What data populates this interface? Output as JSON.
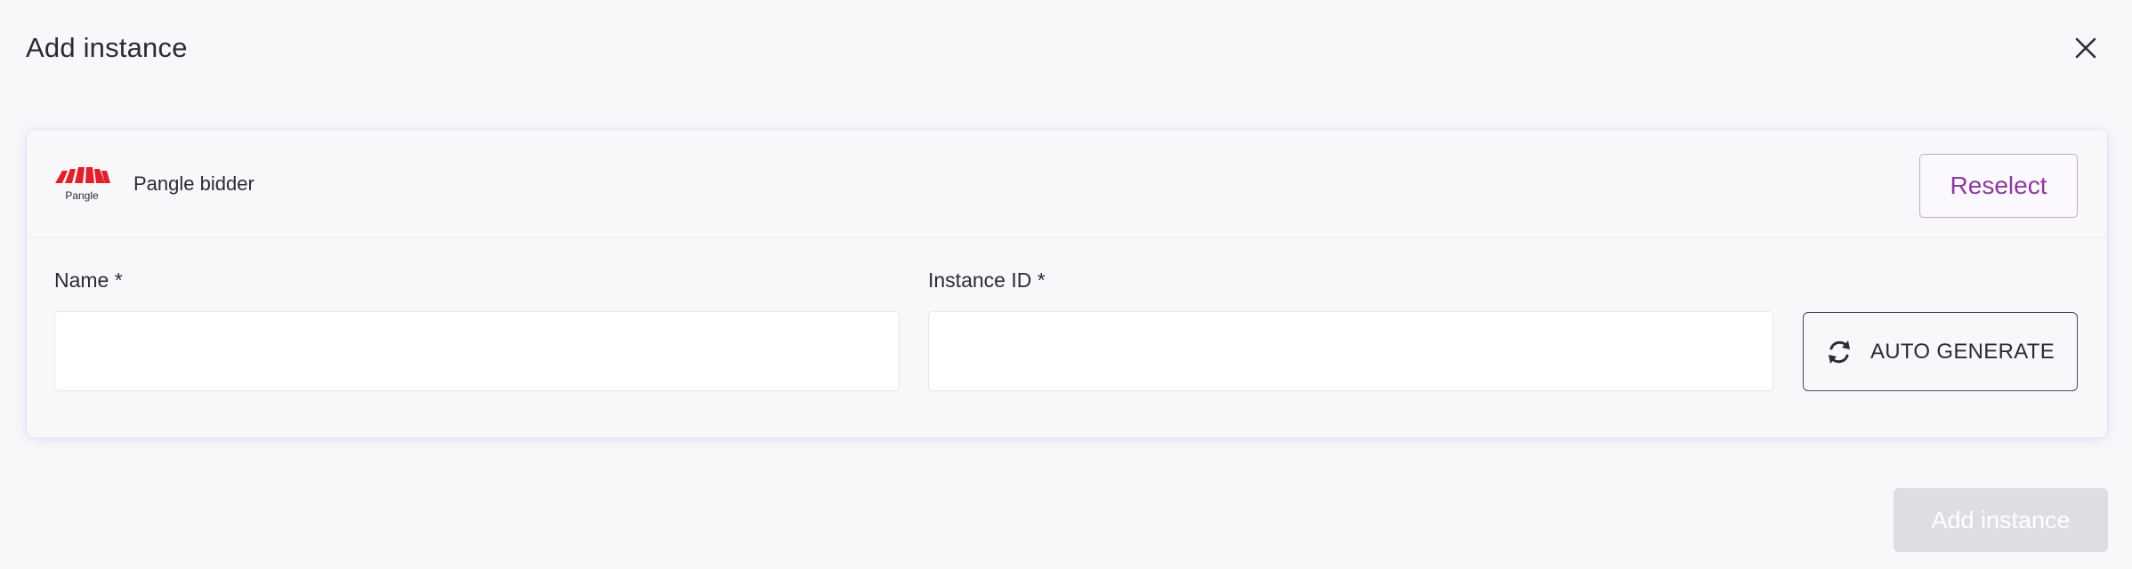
{
  "dialog": {
    "title": "Add instance"
  },
  "provider": {
    "logo_text": "Pangle",
    "name": "Pangle bidder",
    "reselect_label": "Reselect",
    "brand_color": "#e0202b"
  },
  "form": {
    "name_label": "Name *",
    "name_value": "",
    "instance_id_label": "Instance ID *",
    "instance_id_value": "",
    "auto_generate_label": "AUTO GENERATE"
  },
  "footer": {
    "submit_label": "Add instance"
  },
  "icons": {
    "close": "close-icon",
    "refresh": "refresh-icon",
    "logo": "pangle-logo"
  },
  "colors": {
    "accent": "#8a3a9f",
    "accent_border": "#c7a6d8",
    "disabled_button": "#dedee2"
  }
}
